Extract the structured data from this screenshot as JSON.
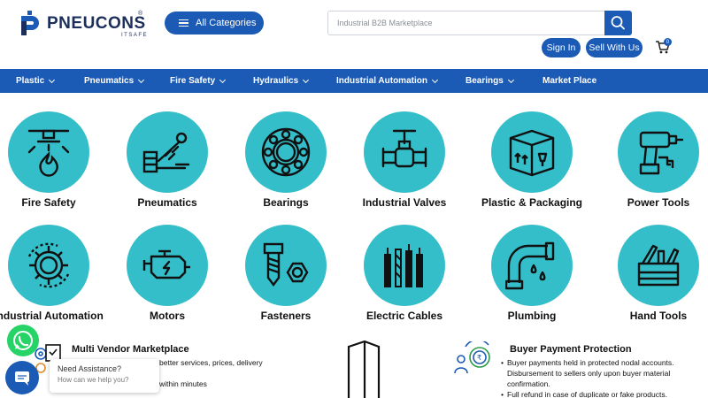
{
  "header": {
    "logo_text": "PNEUCONS",
    "logo_sub": "ITSAFE",
    "logo_reg": "®",
    "all_categories": "All Categories",
    "search_placeholder": "Industrial B2B Marketplace",
    "sign_in": "Sign In",
    "sell_with_us": "Sell With Us",
    "cart_count": "0"
  },
  "nav": [
    {
      "label": "Plastic",
      "dropdown": true
    },
    {
      "label": "Pneumatics",
      "dropdown": true
    },
    {
      "label": "Fire Safety",
      "dropdown": true
    },
    {
      "label": "Hydraulics",
      "dropdown": true
    },
    {
      "label": "Industrial Automation",
      "dropdown": true
    },
    {
      "label": "Bearings",
      "dropdown": true
    },
    {
      "label": "Market Place",
      "dropdown": false
    }
  ],
  "categories": [
    {
      "label": "Fire Safety",
      "icon": "fire-sprinkler-icon"
    },
    {
      "label": "Pneumatics",
      "icon": "pneumatic-cylinder-icon"
    },
    {
      "label": "Bearings",
      "icon": "bearing-icon"
    },
    {
      "label": "Industrial Valves",
      "icon": "valve-icon"
    },
    {
      "label": "Plastic & Packaging",
      "icon": "package-box-icon"
    },
    {
      "label": "Power Tools",
      "icon": "drill-icon"
    },
    {
      "label": "Industrial Automation",
      "icon": "automation-gear-icon"
    },
    {
      "label": "Motors",
      "icon": "engine-icon"
    },
    {
      "label": "Fasteners",
      "icon": "bolt-nut-icon"
    },
    {
      "label": "Electric Cables",
      "icon": "cables-icon"
    },
    {
      "label": "Plumbing",
      "icon": "pipe-icon"
    },
    {
      "label": "Hand Tools",
      "icon": "toolbox-icon"
    }
  ],
  "features": {
    "multi_vendor": {
      "title": "Multi Vendor Marketplace",
      "line1": "better services, prices, delivery",
      "line2": "within minutes"
    },
    "buyer_protection": {
      "title": "Buyer Payment Protection",
      "bullets": [
        "Buyer payments held in protected nodal accounts. Disbursement to sellers only upon buyer material confirmation.",
        "Full refund in case of duplicate or fake products."
      ]
    }
  },
  "chat": {
    "title": "Need Assistance?",
    "subtitle": "How can we help you?"
  },
  "colors": {
    "primary": "#1b5ab5",
    "circle": "#34bec9",
    "whatsapp": "#25d366"
  }
}
